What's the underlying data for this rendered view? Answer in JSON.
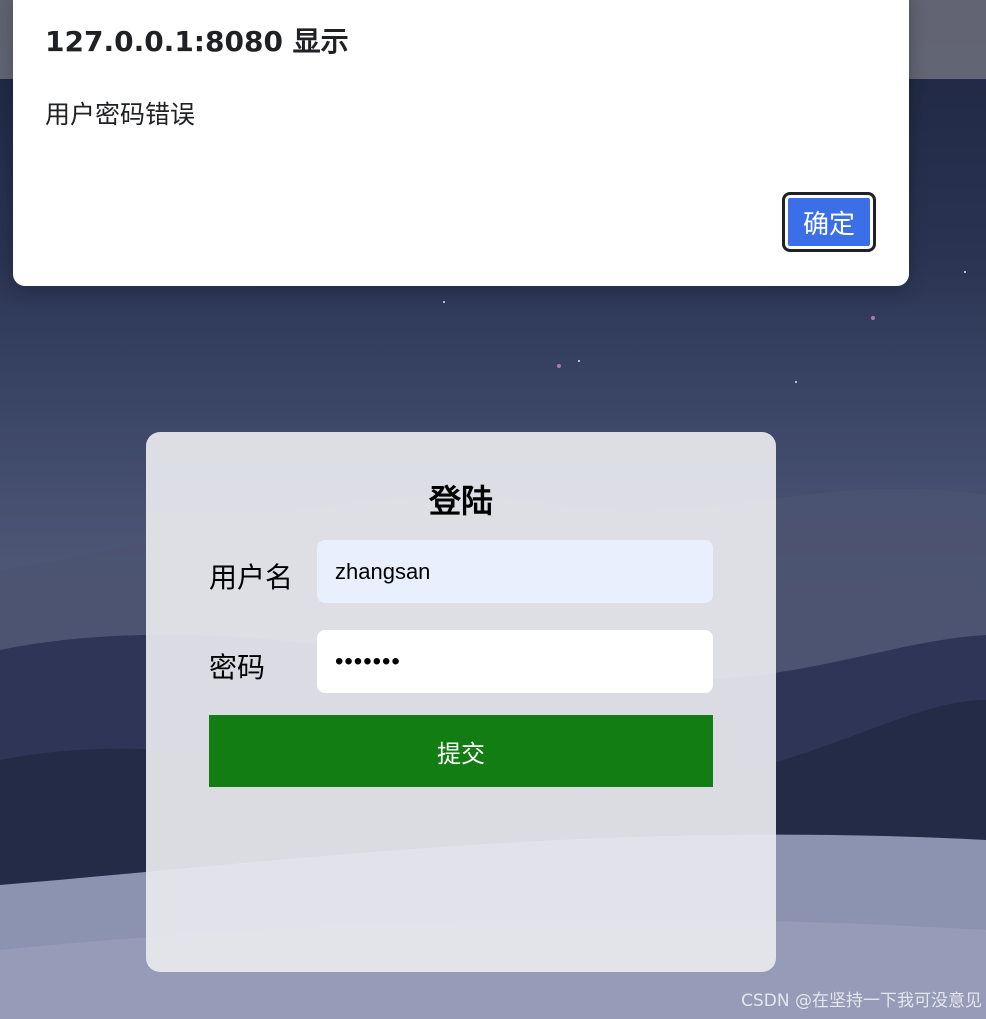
{
  "dialog": {
    "title": "127.0.0.1:8080 显示",
    "message": "用户密码错误",
    "ok_label": "确定"
  },
  "login": {
    "title": "登陆",
    "username_label": "用户名",
    "username_value": "zhangsan",
    "password_label": "密码",
    "password_value": "1234567",
    "submit_label": "提交"
  },
  "watermark": "CSDN @在坚持一下我可没意见",
  "colors": {
    "submit_button": "#127d12",
    "dialog_ok_button": "#3a6fe8",
    "username_autofill_bg": "#e8f0fe"
  }
}
